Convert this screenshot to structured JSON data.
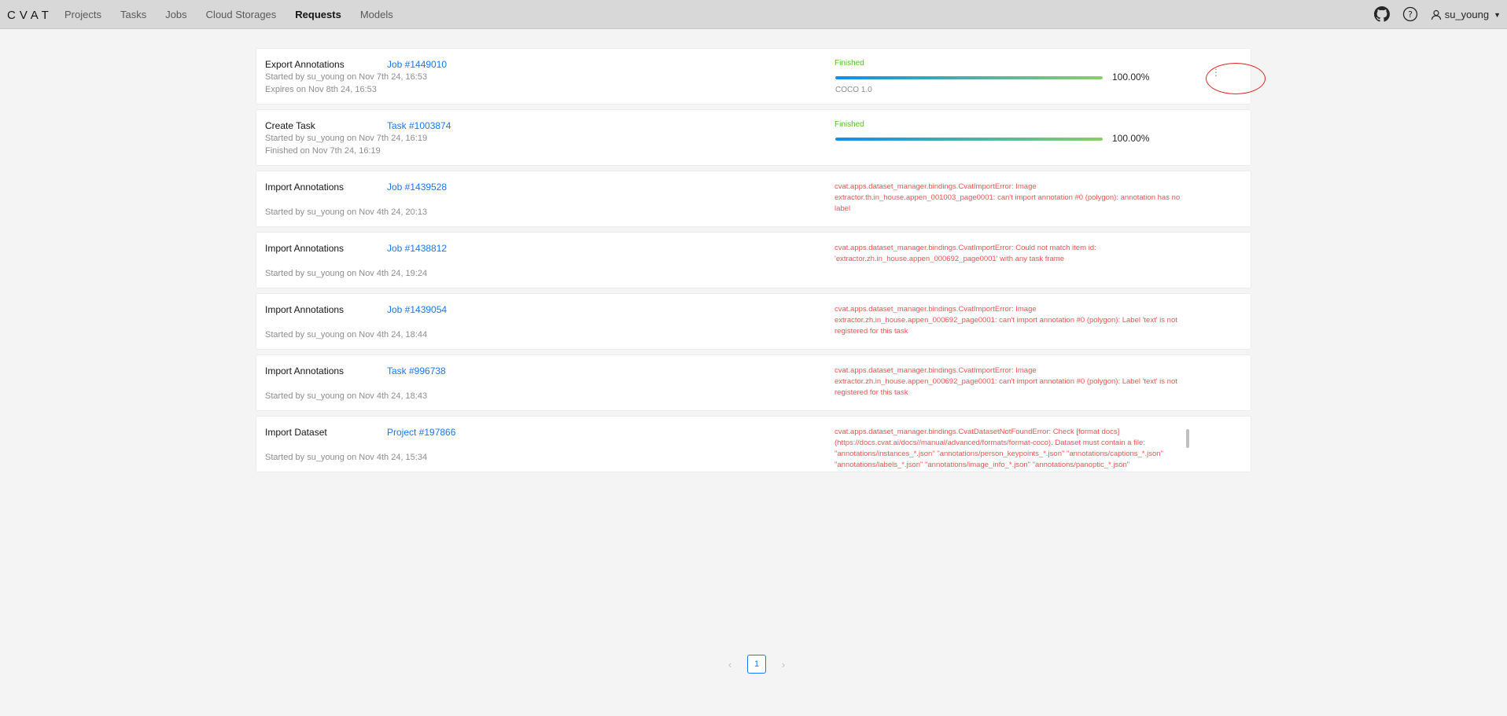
{
  "app": {
    "logo": "CVAT",
    "nav": [
      "Projects",
      "Tasks",
      "Jobs",
      "Cloud Storages",
      "Requests",
      "Models"
    ],
    "active_nav": "Requests",
    "user": "su_young",
    "icons": [
      "github-icon",
      "help-icon",
      "user-icon"
    ]
  },
  "requests": [
    {
      "operation": "Export Annotations",
      "target": "Job #1449010",
      "line1": "Started by su_young on Nov 7th 24, 16:53",
      "line2": "Expires on Nov 8th 24, 16:53",
      "status": "Finished",
      "progress": "100.00%",
      "progress_fraction": 1.0,
      "format": "COCO 1.0"
    },
    {
      "operation": "Create Task",
      "target": "Task #1003874",
      "line1": "Started by su_young on Nov 7th 24, 16:19",
      "line2": "Finished on Nov 7th 24, 16:19",
      "status": "Finished",
      "progress": "100.00%",
      "progress_fraction": 1.0
    },
    {
      "operation": "Import Annotations",
      "target": "Job #1439528",
      "line1": "",
      "line2": "Started by su_young on Nov 4th 24, 20:13",
      "error": "cvat.apps.dataset_manager.bindings.CvatImportError: Image extractor.th.in_house.appen_001003_page0001: can't import annotation #0 (polygon): annotation has no label"
    },
    {
      "operation": "Import Annotations",
      "target": "Job #1438812",
      "line1": "",
      "line2": "Started by su_young on Nov 4th 24, 19:24",
      "error": "cvat.apps.dataset_manager.bindings.CvatImportError: Could not match item id: 'extractor.zh.in_house.appen_000692_page0001' with any task frame"
    },
    {
      "operation": "Import Annotations",
      "target": "Job #1439054",
      "line1": "",
      "line2": "Started by su_young on Nov 4th 24, 18:44",
      "error": "cvat.apps.dataset_manager.bindings.CvatImportError: Image extractor.zh.in_house.appen_000692_page0001: can't import annotation #0 (polygon): Label 'text' is not registered for this task"
    },
    {
      "operation": "Import Annotations",
      "target": "Task #996738",
      "line1": "",
      "line2": "Started by su_young on Nov 4th 24, 18:43",
      "error": "cvat.apps.dataset_manager.bindings.CvatImportError: Image extractor.zh.in_house.appen_000692_page0001: can't import annotation #0 (polygon): Label 'text' is not registered for this task"
    },
    {
      "operation": "Import Dataset",
      "target": "Project #197866",
      "line1": "",
      "line2": "Started by su_young on Nov 4th 24, 15:34",
      "error": "cvat.apps.dataset_manager.bindings.CvatDatasetNotFoundError: Check [format docs](https://docs.cvat.ai/docs//manual/advanced/formats/format-coco). Dataset must contain a file: \"annotations/instances_*.json\" \"annotations/person_keypoints_*.json\" \"annotations/captions_*.json\" \"annotations/labels_*.json\" \"annotations/image_info_*.json\" \"annotations/panoptic_*.json\"",
      "error_scrollable": true
    }
  ],
  "more_button": "⋮",
  "pagination": {
    "prev": "‹",
    "current": "1",
    "next": "›"
  },
  "colors": {
    "finished": "#52c41a",
    "error": "#ff4d4f",
    "link": "#1677ff",
    "highlight": "#e02424"
  }
}
